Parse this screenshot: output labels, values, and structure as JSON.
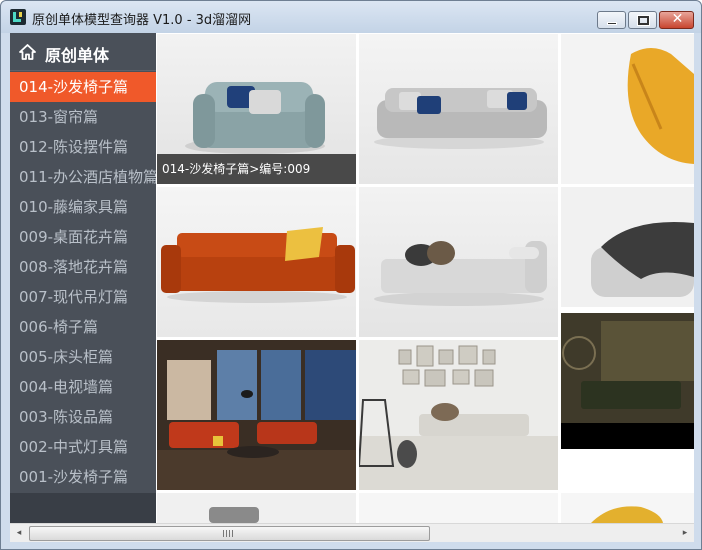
{
  "window": {
    "title": "原创单体模型查询器 V1.0 - 3d溜溜网",
    "close_glyph": "✕"
  },
  "sidebar": {
    "header_title": "原创单体",
    "items": [
      {
        "label": "014-沙发椅子篇"
      },
      {
        "label": "013-窗帘篇"
      },
      {
        "label": "012-陈设摆件篇"
      },
      {
        "label": "011-办公酒店植物篇"
      },
      {
        "label": "010-藤编家具篇"
      },
      {
        "label": "009-桌面花卉篇"
      },
      {
        "label": "008-落地花卉篇"
      },
      {
        "label": "007-现代吊灯篇"
      },
      {
        "label": "006-椅子篇"
      },
      {
        "label": "005-床头柜篇"
      },
      {
        "label": "004-电视墙篇"
      },
      {
        "label": "003-陈设品篇"
      },
      {
        "label": "002-中式灯具篇"
      },
      {
        "label": "001-沙发椅子篇"
      }
    ],
    "active_index": 0
  },
  "grid": {
    "hover_caption": "014-沙发椅子篇>编号:009"
  },
  "colors": {
    "sidebar_bg": "#4a5059",
    "active_item": "#f0592a",
    "item_text": "#b9c0c9"
  },
  "icons": {
    "home": "home-icon",
    "scroll_left": "◂",
    "scroll_right": "▸"
  }
}
